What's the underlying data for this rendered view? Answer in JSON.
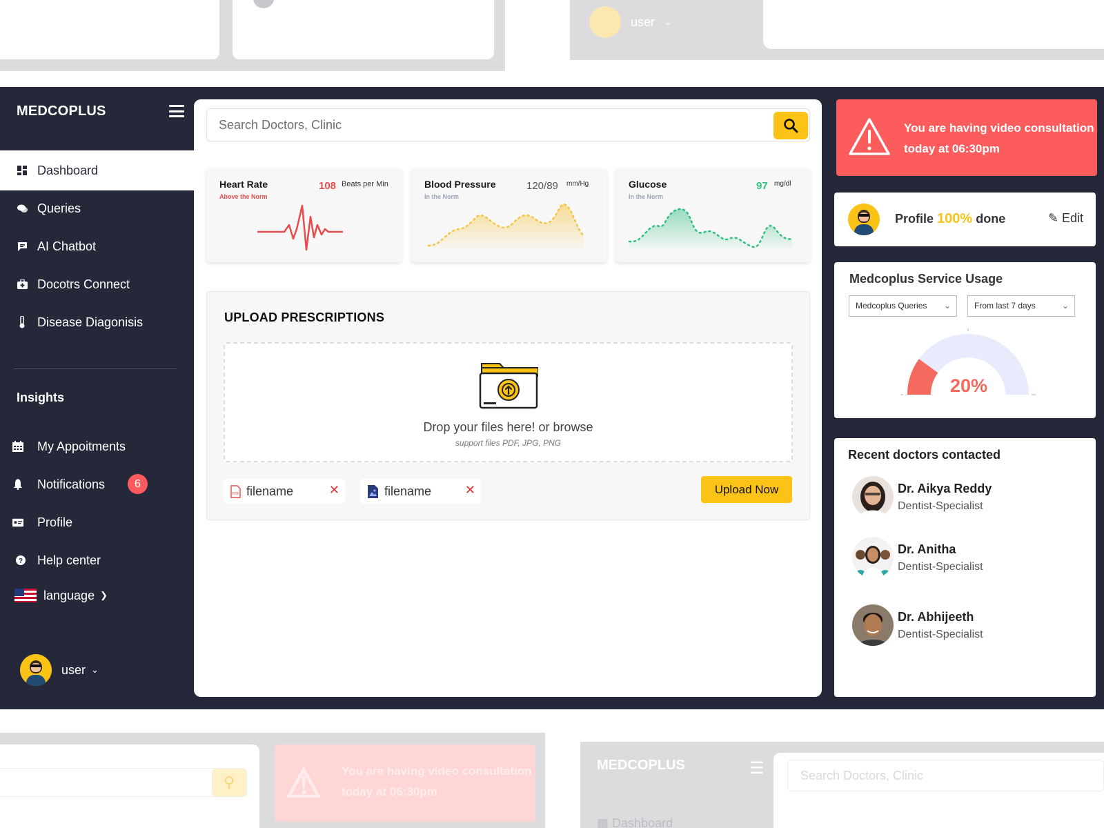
{
  "ghost": {
    "top_user_label": "user",
    "alert_line1": "You are having video consultation",
    "alert_line2": "today at 06:30pm",
    "brand": "MEDCOPLUS",
    "search_placeholder": "Search Doctors, Clinic",
    "dashboard_label": "Dashboard"
  },
  "sidebar": {
    "brand": "MEDCOPLUS",
    "items": [
      {
        "label": "Dashboard",
        "icon": "dashboard-icon"
      },
      {
        "label": "Queries",
        "icon": "chat-icon"
      },
      {
        "label": "AI Chatbot",
        "icon": "message-icon"
      },
      {
        "label": "Docotrs Connect",
        "icon": "medkit-icon"
      },
      {
        "label": "Disease Diagonisis",
        "icon": "thermometer-icon"
      }
    ],
    "insights_heading": "Insights",
    "insights": [
      {
        "label": "My Appoitments",
        "icon": "calendar-icon"
      },
      {
        "label": "Notifications",
        "icon": "bell-icon",
        "badge": "6"
      },
      {
        "label": "Profile",
        "icon": "id-card-icon"
      },
      {
        "label": "Help center",
        "icon": "help-icon"
      }
    ],
    "language_label": "language",
    "user_label": "user"
  },
  "search": {
    "placeholder": "Search Doctors, Clinic"
  },
  "vitals": [
    {
      "title": "Heart Rate",
      "status": "Above the Norm",
      "value": "108",
      "unit": "Beats per Min",
      "color": "#e84b4b"
    },
    {
      "title": "Blood Pressure",
      "status": "In the Norm",
      "value": "120/89",
      "unit": "mm/Hg",
      "color": "#f5c542"
    },
    {
      "title": "Glucose",
      "status": "In the Norm",
      "value": "97",
      "unit": "mg/dl",
      "color": "#2ebf7f"
    }
  ],
  "upload": {
    "title": "UPLOAD PRESCRIPTIONS",
    "drop_text": "Drop your files here! or browse",
    "support_text": "support files PDF, JPG, PNG",
    "files": [
      {
        "name": "filename",
        "icon": "pdf-file-icon"
      },
      {
        "name": "filename",
        "icon": "image-file-icon"
      }
    ],
    "button": "Upload Now"
  },
  "alert": {
    "line1": "You are having video consultation",
    "line2": "today at 06:30pm"
  },
  "profile": {
    "prefix": "Profile",
    "percent": "100%",
    "suffix": "done",
    "edit": "Edit"
  },
  "usage": {
    "title": "Medcoplus Service Usage",
    "select_metric": "Medcoplus Queries",
    "select_range": "From last 7 days",
    "value": "20%",
    "fraction": 0.2,
    "accent": "#f46a5e",
    "track": "#e7ebfb"
  },
  "doctors": {
    "title": "Recent doctors contacted",
    "list": [
      {
        "name": "Dr. Aikya Reddy",
        "specialty": "Dentist-Specialist"
      },
      {
        "name": "Dr. Anitha",
        "specialty": "Dentist-Specialist"
      },
      {
        "name": "Dr. Abhijeeth",
        "specialty": "Dentist-Specialist"
      }
    ]
  },
  "colors": {
    "sidebar_bg": "#252839",
    "accent_yellow": "#fbc316",
    "alert_red": "#fc5c5c"
  }
}
